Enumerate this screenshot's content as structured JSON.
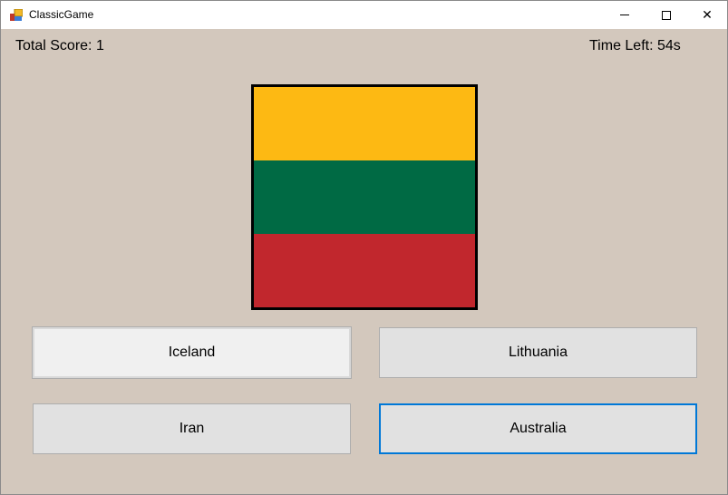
{
  "window": {
    "title": "ClassicGame"
  },
  "header": {
    "score_label": "Total Score:",
    "score_value": "1",
    "time_left": "Time Left: 54s"
  },
  "flag": {
    "colors": [
      "#fdb913",
      "#006a44",
      "#c1272d"
    ]
  },
  "answers": [
    {
      "label": "Iceland"
    },
    {
      "label": "Lithuania"
    },
    {
      "label": "Iran"
    },
    {
      "label": "Australia"
    }
  ],
  "focus_color": "#0078d7"
}
